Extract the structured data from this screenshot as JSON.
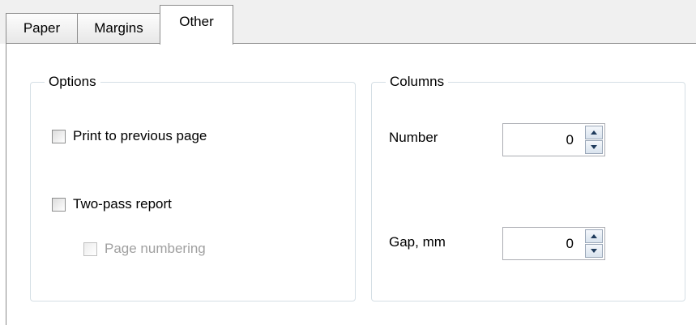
{
  "tabs": [
    {
      "label": "Paper",
      "active": false
    },
    {
      "label": "Margins",
      "active": false
    },
    {
      "label": "Other",
      "active": true
    }
  ],
  "options_group": {
    "title": "Options",
    "print_to_previous_page": {
      "label": "Print to previous page",
      "checked": false,
      "enabled": true
    },
    "two_pass_report": {
      "label": "Two-pass report",
      "checked": false,
      "enabled": true
    },
    "page_numbering": {
      "label": "Page numbering",
      "checked": false,
      "enabled": false
    }
  },
  "columns_group": {
    "title": "Columns",
    "number": {
      "label": "Number",
      "value": "0"
    },
    "gap": {
      "label": "Gap, mm",
      "value": "0"
    }
  }
}
